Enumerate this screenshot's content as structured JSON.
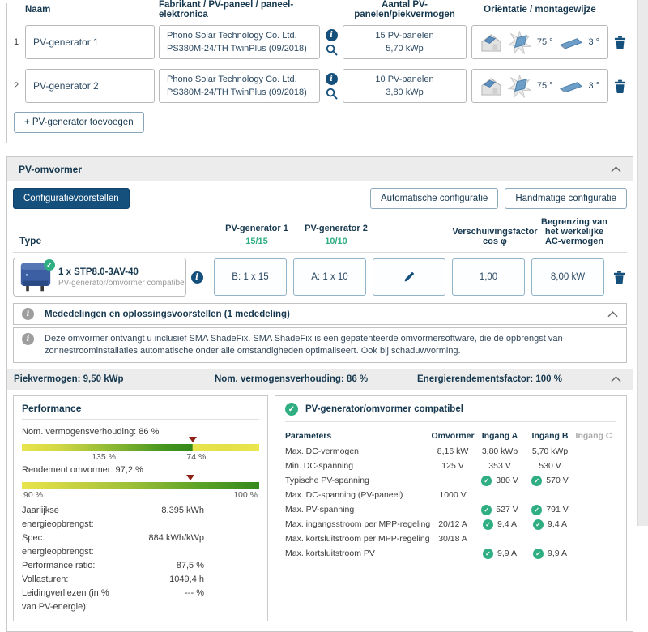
{
  "generators": {
    "columns": [
      "Naam",
      "Fabrikant / PV-paneel / paneel-elektronica",
      "Aantal PV-panelen/piekvermogen",
      "Oriëntatie / montagewijze"
    ],
    "rows": [
      {
        "index": "1",
        "name": "PV-generator 1",
        "manufacturer": "Phono Solar Technology Co. Ltd.",
        "panel": "PS380M-24/TH TwinPlus (09/2018)",
        "count": "15 PV-panelen",
        "peak": "5,70 kWp",
        "azimuth": "75 °",
        "tilt": "3 °"
      },
      {
        "index": "2",
        "name": "PV-generator 2",
        "manufacturer": "Phono Solar Technology Co. Ltd.",
        "panel": "PS380M-24/TH TwinPlus (09/2018)",
        "count": "10 PV-panelen",
        "peak": "3,80 kWp",
        "azimuth": "75 °",
        "tilt": "3 °"
      }
    ],
    "add_button": "+ PV-generator toevoegen"
  },
  "inverter": {
    "section_title": "PV-omvormer",
    "proposals_button": "Configuratievoorstellen",
    "auto_button": "Automatische configuratie",
    "manual_button": "Handmatige configuratie",
    "config": {
      "type_header": "Type",
      "gen1_header": "PV-generator 1",
      "gen1_count": "15/15",
      "gen2_header": "PV-generator 2",
      "gen2_count": "10/10",
      "cos_header": "Verschuivingsfactor cos φ",
      "ac_header": "Begrenzing van het werkelijke AC-vermogen",
      "type_title": "1 x STP8.0-3AV-40",
      "type_status": "PV-generator/omvormer compatibel",
      "gen1_value": "B: 1 x 15",
      "gen2_value": "A: 1 x 10",
      "cos_value": "1,00",
      "ac_value": "8,00 kW"
    },
    "messages": {
      "header": "Mededelingen en oplossingsvoorstellen (1 mededeling)",
      "body": "Deze omvormer ontvangt u inclusief SMA ShadeFix. SMA ShadeFix is een gepatenteerde omvormersoftware, die de opbrengst van zonnestroominstallaties automatische onder alle omstandigheden optimaliseert. Ook bij schaduwvorming."
    },
    "summary": {
      "peak": "Piekvermogen: 9,50 kWp",
      "ratio": "Nom. vermogensverhouding: 86 %",
      "energy": "Energierendementsfactor: 100 %"
    }
  },
  "performance": {
    "title": "Performance",
    "gauge1": {
      "label": "Nom. vermogensverhouding: 86 %",
      "tick_low": "135 %",
      "tick_high": "74 %",
      "marker_pct": 72
    },
    "gauge2": {
      "label": "Rendement omvormer: 97,2 %",
      "tick_low": "90 %",
      "tick_high": "100 %",
      "marker_pct": 71
    },
    "stats": [
      {
        "label": "Jaarlijkse energieopbrengst:",
        "value": "8.395 kWh"
      },
      {
        "label": "Spec. energieopbrengst:",
        "value": "884 kWh/kWp"
      },
      {
        "label": "Performance ratio:",
        "value": "87,5 %"
      },
      {
        "label": "Vollasturen:",
        "value": "1049,4 h"
      },
      {
        "label": "Leidingverliezen (in % van PV-energie):",
        "value": "--- %"
      }
    ]
  },
  "compat": {
    "title": "PV-generator/omvormer compatibel",
    "columns": [
      "Parameters",
      "Omvormer",
      "Ingang A",
      "Ingang B",
      "Ingang C"
    ],
    "rows": [
      {
        "label": "Max. DC-vermogen",
        "omvormer": "8,16 kW",
        "a": "3,80 kWp",
        "b": "5,70 kWp",
        "a_check": false,
        "b_check": false
      },
      {
        "label": "Min. DC-spanning",
        "omvormer": "125 V",
        "a": "353 V",
        "b": "530 V",
        "a_check": false,
        "b_check": false
      },
      {
        "label": "Typische PV-spanning",
        "omvormer": "",
        "a": "380 V",
        "b": "570 V",
        "a_check": true,
        "b_check": true
      },
      {
        "label": "Max. DC-spanning (PV-paneel)",
        "omvormer": "1000 V",
        "a": "",
        "b": "",
        "a_check": false,
        "b_check": false
      },
      {
        "label": "Max. PV-spanning",
        "omvormer": "",
        "a": "527 V",
        "b": "791 V",
        "a_check": true,
        "b_check": true
      },
      {
        "label": "Max. ingangsstroom per MPP-regeling",
        "omvormer": "20/12 A",
        "a": "9,4 A",
        "b": "9,4 A",
        "a_check": true,
        "b_check": true
      },
      {
        "label": "Max. kortsluitstroom per MPP-regeling",
        "omvormer": "30/18 A",
        "a": "",
        "b": "",
        "a_check": false,
        "b_check": false
      },
      {
        "label": "Max. kortsluitstroom PV",
        "omvormer": "",
        "a": "9,9 A",
        "b": "9,9 A",
        "a_check": true,
        "b_check": true
      }
    ]
  },
  "colors": {
    "accent_blue": "#15507d",
    "status_green": "#2fae82",
    "marker_red": "#8e2016",
    "header_text": "#16384f",
    "section_bg": "#ececec"
  }
}
